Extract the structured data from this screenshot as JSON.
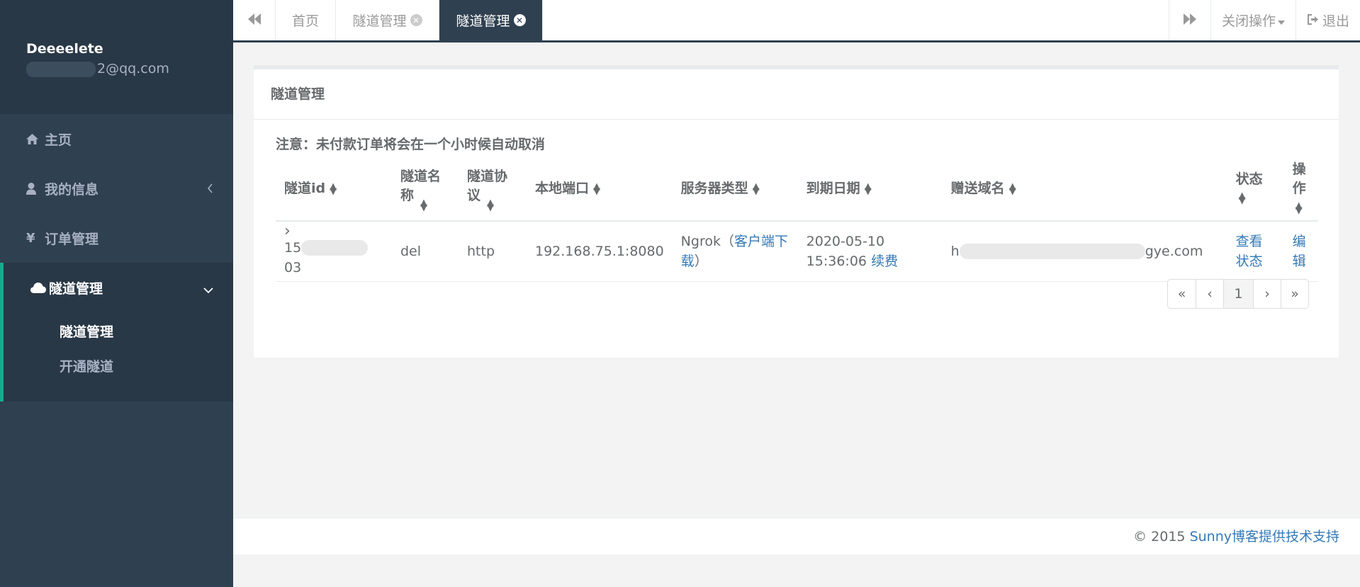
{
  "user": {
    "name": "Deeeelete",
    "email_suffix": "2@qq.com"
  },
  "sidebar": {
    "items": [
      {
        "label": "主页",
        "icon": "home-icon"
      },
      {
        "label": "我的信息",
        "icon": "user-icon"
      },
      {
        "label": "订单管理",
        "icon": "yen-icon"
      },
      {
        "label": "隧道管理",
        "icon": "cloud-icon"
      }
    ],
    "sub_items": [
      {
        "label": "隧道管理"
      },
      {
        "label": "开通隧道"
      }
    ]
  },
  "tabs": {
    "home": "首页",
    "tunnel1": "隧道管理",
    "tunnel2": "隧道管理",
    "close_ops": "关闭操作",
    "logout": "退出"
  },
  "panel": {
    "title": "隧道管理",
    "notice": "注意：未付款订单将会在一个小时候自动取消"
  },
  "table": {
    "headers": {
      "id": "隧道id",
      "name": "隧道名称",
      "protocol": "隧道协议",
      "port": "本地端口",
      "server": "服务器类型",
      "expire": "到期日期",
      "domain": "赠送域名",
      "status": "状态",
      "ops": "操作"
    },
    "row": {
      "expand": "›",
      "id_prefix": "15",
      "id_suffix": "03",
      "name": "del",
      "protocol": "http",
      "port": "192.168.75.1:8080",
      "server": "Ngrok",
      "client_download": "客户端下载",
      "expire_date": "2020-05-10",
      "expire_time": "15:36:06",
      "renew": "续费",
      "domain_prefix": "h",
      "domain_suffix": "gye.com",
      "status": "查看状态",
      "edit": "编辑"
    }
  },
  "pagination": {
    "first": "«",
    "prev": "‹",
    "page": "1",
    "next": "›",
    "last": "»"
  },
  "footer": {
    "copyright": "© 2015",
    "link": "Sunny博客提供技术支持"
  },
  "colors": {
    "sidebar": "#2f4050",
    "accent": "#19aa8d",
    "link": "#337ab7"
  }
}
